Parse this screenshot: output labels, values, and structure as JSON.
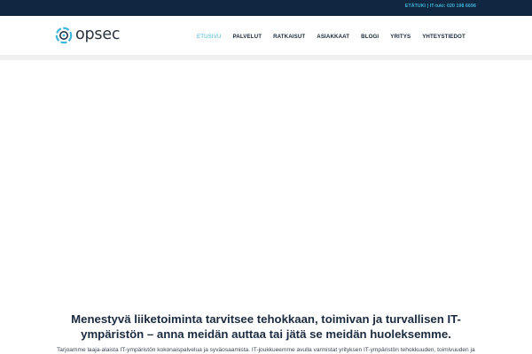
{
  "topbar": {
    "contact_text": "ETÄTUKI | IT-tuki: 020 198 6696"
  },
  "brand": {
    "name": "opsec",
    "logo_icon": "opsec-logo-icon",
    "accent_color": "#3fb5d9",
    "dark_color": "#0f2740"
  },
  "nav": {
    "items": [
      {
        "label": "ETUSIVU",
        "active": true
      },
      {
        "label": "PALVELUT",
        "active": false
      },
      {
        "label": "RATKAISUT",
        "active": false
      },
      {
        "label": "ASIAKKAAT",
        "active": false
      },
      {
        "label": "BLOGI",
        "active": false
      },
      {
        "label": "YRITYS",
        "active": false
      },
      {
        "label": "YHTEYSTIEDOT",
        "active": false
      }
    ]
  },
  "main": {
    "headline": "Menestyvä liiketoiminta tarvitsee tehokkaan, toimivan ja turvallisen IT-ympäristön – anna meidän auttaa tai jätä se meidän huoleksemme.",
    "body": "Tarjoamme laaja-alaista IT-ympäristön kokonaispalvelua ja syväosaamista. IT-joukkueemme avulla varmistat yrityksen IT-ympäristön tehokkuuden, toimivuuden ja"
  }
}
